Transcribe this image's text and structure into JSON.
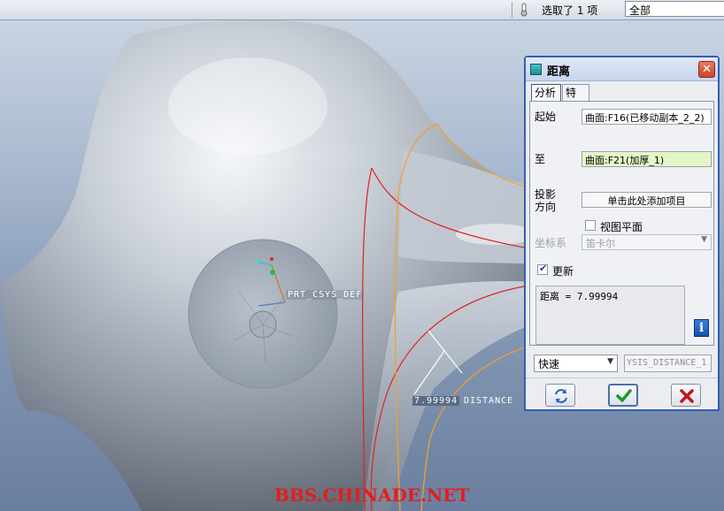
{
  "topbar": {
    "selection_status": "选取了 1 项",
    "filter_value": "全部"
  },
  "viewport": {
    "csys_label": "PRT_CSYS_DEF",
    "distance_value": "7.99994",
    "distance_name": "DISTANCE",
    "watermark": "BBS.CHINADE.NET"
  },
  "dialog": {
    "title": "距离",
    "tabs": [
      "分析",
      "特征"
    ],
    "from_label": "起始",
    "from_value": "曲面:F16(已移动副本_2_2)",
    "to_label": "至",
    "to_value": "曲面:F21(加厚_1)",
    "projection_label_1": "投影",
    "projection_label_2": "方向",
    "projection_value": "单击此处添加项目",
    "view_plane_label": "视图平面",
    "csys_label": "坐标系",
    "csys_value": "笛卡尔",
    "refresh_label": "更新",
    "refresh_checked": true,
    "result_text": "距离 = 7.99994",
    "mode_value": "快速",
    "analysis_name": "YSIS_DISTANCE_1"
  },
  "colors": {
    "dialog_border": "#2f5fb8",
    "to_field_bg": "#e3f7c6",
    "curve_red": "#e02020",
    "curve_orange": "#f0a030",
    "watermark": "#e81b1b"
  }
}
